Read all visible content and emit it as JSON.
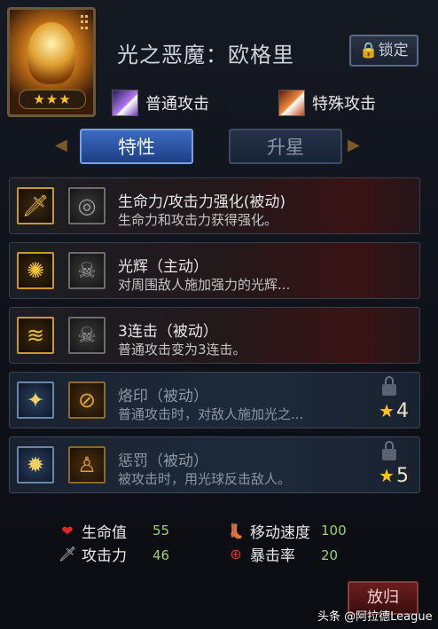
{
  "hero": {
    "name": "光之恶魔：欧格里",
    "stars": "★★★",
    "lock_label": "锁定"
  },
  "attacks": {
    "normal": "普通攻击",
    "special": "特殊攻击"
  },
  "tabs": [
    {
      "label": "特性",
      "active": true
    },
    {
      "label": "升星",
      "active": false
    }
  ],
  "skills": [
    {
      "name": "生命力/攻击力强化(被动)",
      "desc": "生命力和攻击力获得强化。",
      "icon": "sword-icon",
      "type_icon": "target-icon",
      "locked": false
    },
    {
      "name": "光辉（主动）",
      "desc": "对周围敌人施加强力的光辉...",
      "icon": "sun-icon",
      "type_icon": "skull-icon",
      "locked": false
    },
    {
      "name": "3连击（被动）",
      "desc": "普通攻击变为3连击。",
      "icon": "slash-icon",
      "type_icon": "skull-icon",
      "locked": false
    },
    {
      "name": "烙印（被动）",
      "desc": "普通攻击时，对敌人施加光之...",
      "icon": "brand-icon",
      "type_icon": "no-attack-icon",
      "locked": true,
      "req_star": "4"
    },
    {
      "name": "惩罚（被动）",
      "desc": "被攻击时，用光球反击敌人。",
      "icon": "orb-icon",
      "type_icon": "body-icon",
      "locked": true,
      "req_star": "5"
    }
  ],
  "stats": {
    "hp_label": "生命值",
    "hp_value": "55",
    "atk_label": "攻击力",
    "atk_value": "46",
    "speed_label": "移动速度",
    "speed_value": "100",
    "crit_label": "暴击率",
    "crit_value": "20"
  },
  "return_label": "放归",
  "watermark": "头条 @阿拉德League"
}
